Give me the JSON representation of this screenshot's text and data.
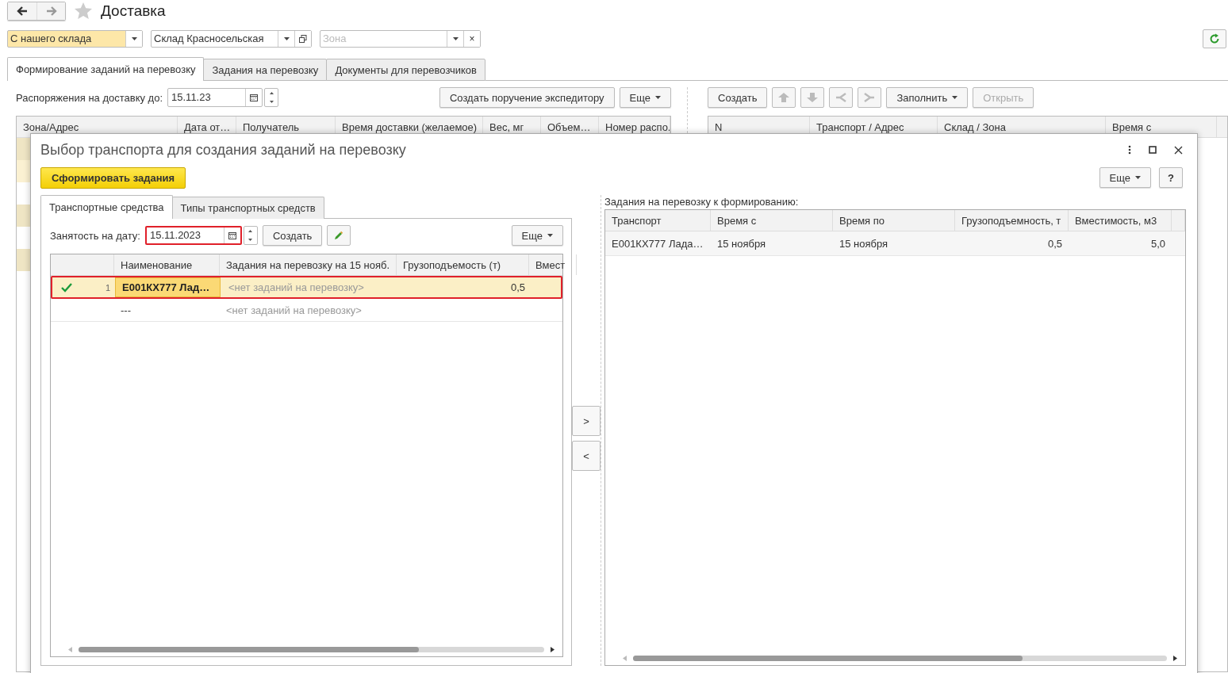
{
  "title": "Доставка",
  "filters": [
    {
      "value": "С нашего склада",
      "accent": true,
      "kind": "select"
    },
    {
      "value": "Склад Красносельская",
      "accent": false,
      "kind": "select-open"
    },
    {
      "placeholder": "Зона",
      "accent": false,
      "kind": "select-clear"
    }
  ],
  "clear_symbol": "×",
  "tabs": [
    {
      "label": "Формирование заданий на перевозку",
      "selected": true
    },
    {
      "label": "Задания на перевозку",
      "selected": false
    },
    {
      "label": "Документы для перевозчиков",
      "selected": false
    }
  ],
  "toolbar": {
    "label": "Распоряжения на доставку до:",
    "date": "15.11.23",
    "buttons": [
      {
        "label": "Создать поручение экспедитору",
        "menu": false
      },
      {
        "label": "Еще",
        "menu": true
      }
    ]
  },
  "right_toolbar": [
    {
      "kind": "text",
      "label": "Создать",
      "disabled": false
    },
    {
      "kind": "up",
      "disabled": true
    },
    {
      "kind": "down",
      "disabled": true
    },
    {
      "kind": "merge",
      "disabled": true
    },
    {
      "kind": "split",
      "disabled": true
    },
    {
      "kind": "menu",
      "label": "Заполнить",
      "disabled": false
    },
    {
      "kind": "text",
      "label": "Открыть",
      "disabled": true
    }
  ],
  "orders_table": {
    "columns": [
      "Зона/Адрес",
      "Дата от…",
      "Получатель",
      "Время доставки (желаемое)",
      "Вес, мг",
      "Объем…",
      "Номер распо."
    ]
  },
  "tasks_table": {
    "columns": [
      "N",
      "Транспорт / Адрес",
      "Склад / Зона",
      "Время с"
    ]
  },
  "dialog": {
    "title": "Выбор транспорта для создания заданий на перевозку",
    "primary_button": "Сформировать задания",
    "more_button": "Еще",
    "help_button": "?",
    "tabs": [
      {
        "label": "Транспортные средства",
        "selected": true
      },
      {
        "label": "Типы транспортных средств",
        "selected": false
      }
    ],
    "date_label": "Занятость на дату:",
    "date": "15.11.2023",
    "date_highlighted": true,
    "create_button": "Создать",
    "panel_more_button": "Еще",
    "vehicles": {
      "columns": [
        "Наименование",
        "Задания на перевозку на 15 нояб.",
        "Грузоподъемость (т)",
        "Вмест"
      ],
      "rows": [
        {
          "checked": true,
          "number": "1",
          "name": "Е001КХ777 Лад…",
          "tasks": "<нет заданий на перевозку>",
          "capacity": "0,5",
          "selected": true
        },
        {
          "checked": false,
          "number": "",
          "name": "---",
          "tasks": "<нет заданий на перевозку>",
          "capacity": "",
          "selected": false
        }
      ]
    },
    "move_buttons": [
      ">",
      "<"
    ],
    "result_label": "Задания на перевозку к формированию:",
    "result": {
      "columns": [
        "Транспорт",
        "Время с",
        "Время по",
        "Грузоподъемность, т",
        "Вместимость, м3"
      ],
      "rows": [
        {
          "cells": [
            "Е001КХ777 Лада…",
            "15 ноября",
            "15 ноября",
            "0,5",
            "5,0"
          ]
        }
      ]
    }
  }
}
